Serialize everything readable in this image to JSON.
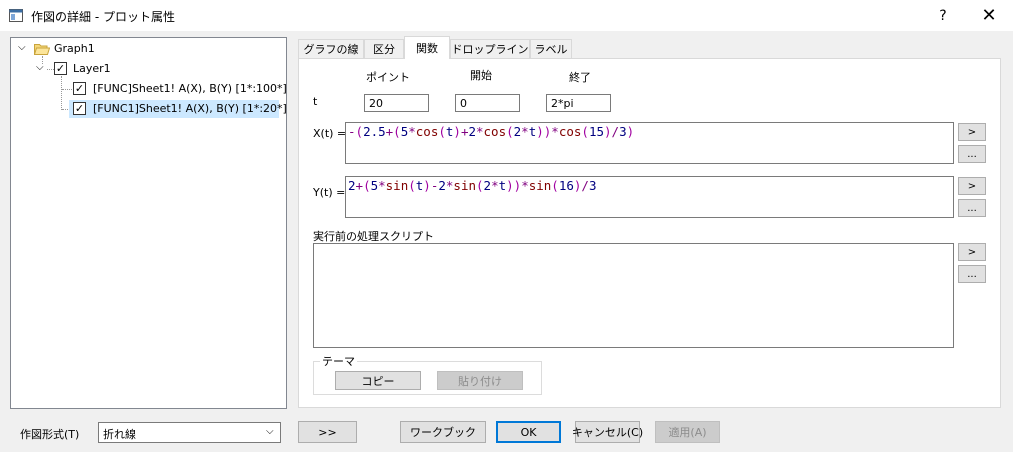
{
  "window": {
    "title": "作図の詳細 - プロット属性",
    "help_label": "?",
    "close_label": "✕"
  },
  "tree": {
    "root": {
      "label": "Graph1",
      "icon": "folder-open-icon"
    },
    "layer": {
      "label": "Layer1",
      "checked": true
    },
    "items": [
      {
        "label": "[FUNC]Sheet1! A(X), B(Y) [1*:100*]",
        "checked": true,
        "selected": false
      },
      {
        "label": "[FUNC1]Sheet1! A(X), B(Y) [1*:20*]",
        "checked": true,
        "selected": true
      }
    ]
  },
  "tabs": [
    {
      "label": "グラフの線",
      "active": false
    },
    {
      "label": "区分",
      "active": false
    },
    {
      "label": "関数",
      "active": true
    },
    {
      "label": "ドロップライン",
      "active": false
    },
    {
      "label": "ラベル",
      "active": false
    }
  ],
  "function_tab": {
    "col_headers": {
      "points": "ポイント",
      "start": "開始",
      "end": "終了"
    },
    "t_label": "t",
    "points_value": "20",
    "start_value": "0",
    "end_value": "2*pi",
    "x_label": "X(t) =",
    "y_label": "Y(t) =",
    "x_expr_tokens": [
      {
        "t": "-",
        "c": "op"
      },
      {
        "t": "(",
        "c": "p"
      },
      {
        "t": "2.5",
        "c": "num"
      },
      {
        "t": "+",
        "c": "op"
      },
      {
        "t": "(",
        "c": "p"
      },
      {
        "t": "5",
        "c": "num"
      },
      {
        "t": "*",
        "c": "op"
      },
      {
        "t": "cos",
        "c": "fn"
      },
      {
        "t": "(",
        "c": "p"
      },
      {
        "t": "t",
        "c": "var"
      },
      {
        "t": ")",
        "c": "p"
      },
      {
        "t": "+",
        "c": "op"
      },
      {
        "t": "2",
        "c": "num"
      },
      {
        "t": "*",
        "c": "op"
      },
      {
        "t": "cos",
        "c": "fn"
      },
      {
        "t": "(",
        "c": "p"
      },
      {
        "t": "2",
        "c": "num"
      },
      {
        "t": "*",
        "c": "op"
      },
      {
        "t": "t",
        "c": "var"
      },
      {
        "t": "))",
        "c": "p"
      },
      {
        "t": "*",
        "c": "op"
      },
      {
        "t": "cos",
        "c": "fn"
      },
      {
        "t": "(",
        "c": "p"
      },
      {
        "t": "15",
        "c": "num"
      },
      {
        "t": ")",
        "c": "p"
      },
      {
        "t": "/",
        "c": "op"
      },
      {
        "t": "3",
        "c": "num"
      },
      {
        "t": ")",
        "c": "p"
      }
    ],
    "y_expr_tokens": [
      {
        "t": "2",
        "c": "num"
      },
      {
        "t": "+",
        "c": "op"
      },
      {
        "t": "(",
        "c": "p"
      },
      {
        "t": "5",
        "c": "num"
      },
      {
        "t": "*",
        "c": "op"
      },
      {
        "t": "sin",
        "c": "fn"
      },
      {
        "t": "(",
        "c": "p"
      },
      {
        "t": "t",
        "c": "var"
      },
      {
        "t": ")",
        "c": "p"
      },
      {
        "t": "-",
        "c": "op"
      },
      {
        "t": "2",
        "c": "num"
      },
      {
        "t": "*",
        "c": "op"
      },
      {
        "t": "sin",
        "c": "fn"
      },
      {
        "t": "(",
        "c": "p"
      },
      {
        "t": "2",
        "c": "num"
      },
      {
        "t": "*",
        "c": "op"
      },
      {
        "t": "t",
        "c": "var"
      },
      {
        "t": "))",
        "c": "p"
      },
      {
        "t": "*",
        "c": "op"
      },
      {
        "t": "sin",
        "c": "fn"
      },
      {
        "t": "(",
        "c": "p"
      },
      {
        "t": "16",
        "c": "num"
      },
      {
        "t": ")",
        "c": "p"
      },
      {
        "t": "/",
        "c": "op"
      },
      {
        "t": "3",
        "c": "num"
      }
    ],
    "script_label": "実行前の処理スクリプト",
    "script_value": "",
    "arrow_label": ">",
    "more_label": "...",
    "theme_label": "テーマ",
    "copy_label": "コピー",
    "paste_label": "貼り付け"
  },
  "bottom": {
    "plot_type_label": "作図形式(T)",
    "plot_type_value": "折れ線",
    "expand_label": ">>",
    "workbook_label": "ワークブック",
    "ok_label": "OK",
    "cancel_label": "キャンセル(C)",
    "apply_label": "適用(A)"
  },
  "colors": {
    "selection": "#cce8ff",
    "default_button_border": "#0078d7",
    "operator": "#800080",
    "function": "#800000",
    "number": "#000080"
  }
}
